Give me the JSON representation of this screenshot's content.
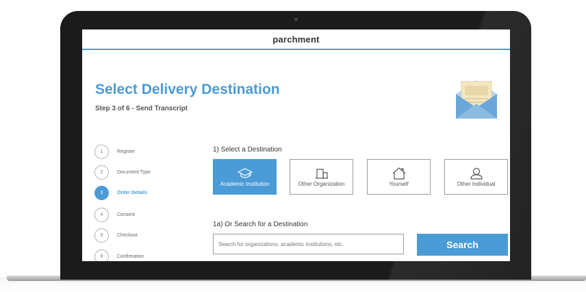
{
  "brand": {
    "name": "parchment"
  },
  "header": {
    "title": "Select Delivery Destination",
    "subtitle": "Step 3 of 6 - Send Transcript"
  },
  "steps": [
    {
      "number": "1",
      "label": "Register",
      "active": false
    },
    {
      "number": "2",
      "label": "Document Type",
      "active": false
    },
    {
      "number": "3",
      "label": "Order Details",
      "active": true
    },
    {
      "number": "4",
      "label": "Consent",
      "active": false
    },
    {
      "number": "5",
      "label": "Checkout",
      "active": false
    },
    {
      "number": "6",
      "label": "Confirmation",
      "active": false
    }
  ],
  "destination": {
    "section_title": "1) Select a Destination",
    "options": [
      {
        "label": "Academic Institution",
        "icon": "graduation-cap-icon",
        "selected": true
      },
      {
        "label": "Other Organization",
        "icon": "building-icon",
        "selected": false
      },
      {
        "label": "Yourself",
        "icon": "home-icon",
        "selected": false
      },
      {
        "label": "Other Individual",
        "icon": "person-icon",
        "selected": false
      }
    ]
  },
  "search": {
    "section_title": "1a) Or Search for a Destination",
    "placeholder": "Search for organizations, academic institutions, etc.",
    "value": "",
    "button_label": "Search"
  },
  "colors": {
    "accent": "#4a9bd6",
    "bezel": "#1b1b1b",
    "text": "#333333"
  },
  "icons": {
    "hero": "envelope-icon"
  }
}
